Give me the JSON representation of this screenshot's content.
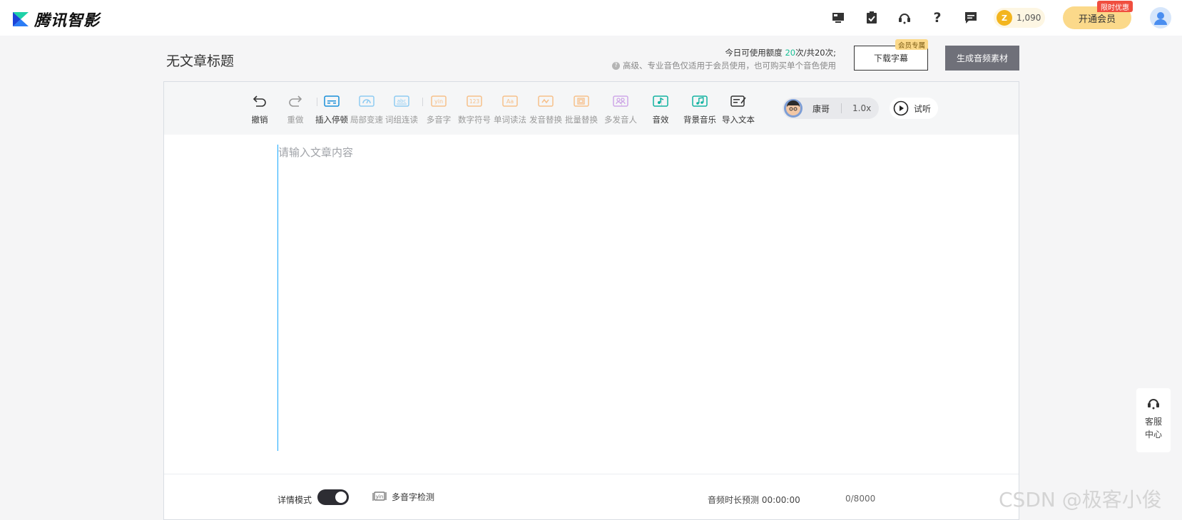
{
  "app": {
    "name": "腾讯智影"
  },
  "topbar": {
    "coins": "1,090",
    "vip_button": "开通会员",
    "vip_tag": "限时优惠"
  },
  "header": {
    "title": "无文章标题",
    "quota_prefix": "今日可使用额度 ",
    "quota_used": "20",
    "quota_suffix": "次/共20次;",
    "quota_note": "高级、专业音色仅适用于会员使用，也可购买单个音色使用",
    "download_subtitles": "下载字幕",
    "member_only_tag": "会员专属",
    "generate_audio": "生成音频素材"
  },
  "toolbar": {
    "undo": "撤销",
    "redo": "重做",
    "insert_pause": "插入停顿",
    "local_speed": "局部变速",
    "word_link": "词组连读",
    "polyphone": "多音字",
    "number_symbol": "数字符号",
    "word_reading": "单词读法",
    "pron_replace": "发音替换",
    "batch_replace": "批量替换",
    "multi_speaker": "多发音人",
    "sound_effect": "音效",
    "bgm": "背景音乐",
    "import_text": "导入文本",
    "voice_name": "康哥",
    "voice_speed": "1.0x",
    "listen": "试听"
  },
  "editor": {
    "placeholder": "请输入文章内容"
  },
  "footer": {
    "detail_mode": "详情模式",
    "detail_mode_on": true,
    "polyphone_check": "多音字检测",
    "duration_label": "音频时长预测",
    "duration_value": "00:00:00",
    "char_count": "0/8000"
  },
  "service": {
    "line1": "客服",
    "line2": "中心"
  },
  "watermark": "CSDN @极客小俊",
  "colors": {
    "accent_green": "#1bbf96",
    "vip_gold": "#fbd98a",
    "tag_red": "#f04e3f",
    "dark_button": "#6f7079"
  }
}
